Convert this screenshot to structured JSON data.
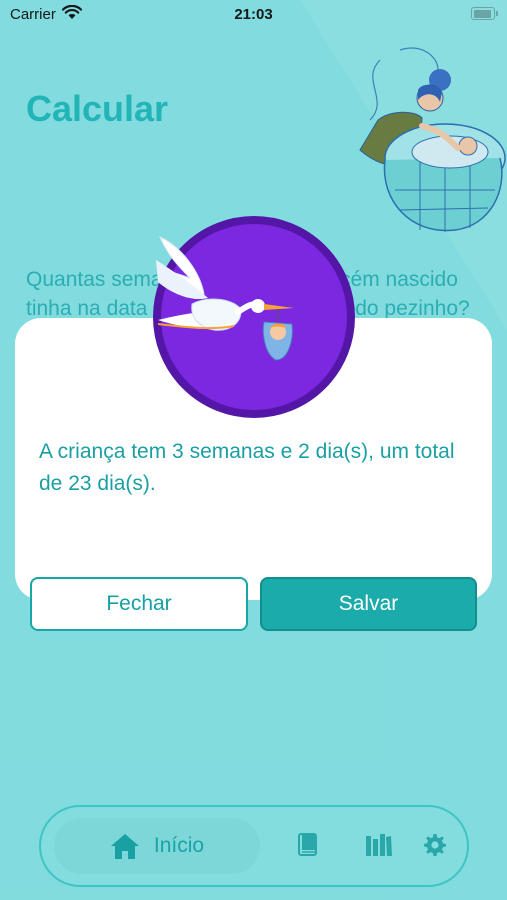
{
  "status_bar": {
    "carrier": "Carrier",
    "time": "21:03"
  },
  "page": {
    "title": "Calcular",
    "question": "Quantas semanas e dias o seu recém nascido tinha na data do resultado do teste do pezinho?"
  },
  "dialog": {
    "message": "A criança tem 3 semanas e 2 dia(s), um total de 23 dia(s).",
    "close_label": "Fechar",
    "save_label": "Salvar"
  },
  "tabbar": {
    "items": [
      {
        "label": "Início",
        "icon": "home-icon",
        "active": true
      },
      {
        "label": "",
        "icon": "book-icon",
        "active": false
      },
      {
        "label": "",
        "icon": "library-icon",
        "active": false
      },
      {
        "label": "",
        "icon": "gear-icon",
        "active": false
      }
    ]
  },
  "colors": {
    "background": "#86e0e2",
    "accent": "#1aabaa",
    "badge": "#7b28e0",
    "badge_border": "#5316a7",
    "text_teal": "#1a9fa3"
  }
}
